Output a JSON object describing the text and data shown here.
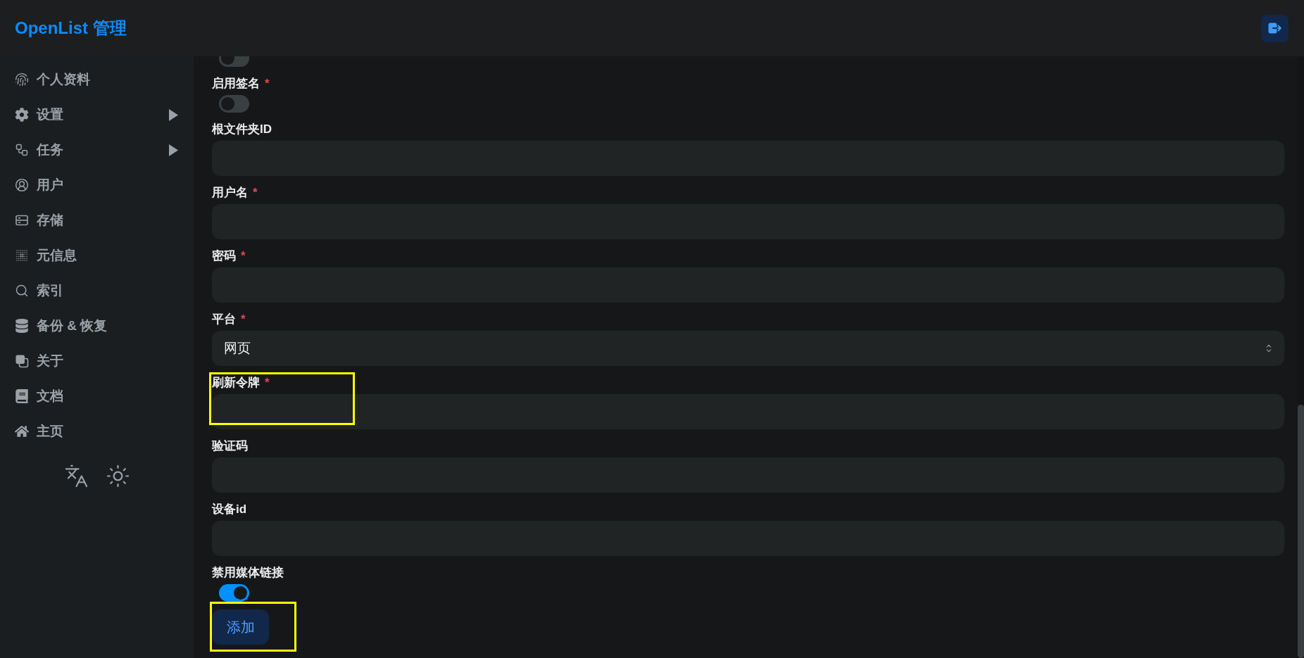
{
  "header": {
    "title": "OpenList 管理"
  },
  "sidebar": {
    "items": [
      {
        "label": "个人资料",
        "expandable": false
      },
      {
        "label": "设置",
        "expandable": true
      },
      {
        "label": "任务",
        "expandable": true
      },
      {
        "label": "用户",
        "expandable": false
      },
      {
        "label": "存储",
        "expandable": false
      },
      {
        "label": "元信息",
        "expandable": false
      },
      {
        "label": "索引",
        "expandable": false
      },
      {
        "label": "备份 & 恢复",
        "expandable": false
      },
      {
        "label": "关于",
        "expandable": false
      },
      {
        "label": "文档",
        "expandable": false
      },
      {
        "label": "主页",
        "expandable": false
      }
    ]
  },
  "form": {
    "partial_toggle": {
      "on": false
    },
    "fields": [
      {
        "kind": "toggle",
        "label": "启用签名",
        "required_mark": "*",
        "on": false,
        "highlighted": false
      },
      {
        "kind": "input",
        "label": "根文件夹ID",
        "highlighted": false
      },
      {
        "kind": "input",
        "label": "用户名",
        "required_mark": "*",
        "highlighted": false
      },
      {
        "kind": "input",
        "label": "密码",
        "required_mark": "*",
        "highlighted": false
      },
      {
        "kind": "select",
        "label": "平台",
        "required_mark": "*",
        "value": "网页",
        "highlighted": false
      },
      {
        "kind": "input",
        "label": "刷新令牌",
        "required_mark": "*",
        "highlighted": true
      },
      {
        "kind": "input",
        "label": "验证码",
        "highlighted": false
      },
      {
        "kind": "input",
        "label": "设备id",
        "highlighted": false
      },
      {
        "kind": "toggle",
        "label": "禁用媒体链接",
        "on": true,
        "highlighted": false
      }
    ],
    "submit": {
      "label": "添加",
      "highlighted": true
    }
  }
}
